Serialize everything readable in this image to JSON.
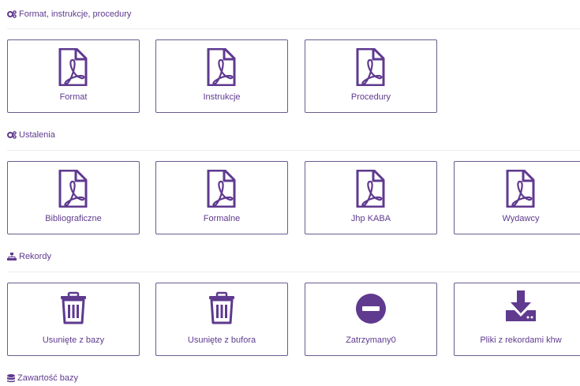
{
  "sections": [
    {
      "title": "Format, instrukcje, procedury",
      "icon": "cogs-icon",
      "tiles": [
        {
          "label": "Format",
          "icon": "pdf-file-icon"
        },
        {
          "label": "Instrukcje",
          "icon": "pdf-file-icon"
        },
        {
          "label": "Procedury",
          "icon": "pdf-file-icon"
        }
      ]
    },
    {
      "title": "Ustalenia",
      "icon": "cogs-icon",
      "tiles": [
        {
          "label": "Bibliograficzne",
          "icon": "pdf-file-icon"
        },
        {
          "label": "Formalne",
          "icon": "pdf-file-icon"
        },
        {
          "label": "Jhp KABA",
          "icon": "pdf-file-icon"
        },
        {
          "label": "Wydawcy",
          "icon": "pdf-file-icon"
        }
      ]
    },
    {
      "title": "Rekordy",
      "icon": "sitemap-icon",
      "tiles": [
        {
          "label": "Usunięte z bazy",
          "icon": "trash-icon"
        },
        {
          "label": "Usunięte z bufora",
          "icon": "trash-icon"
        },
        {
          "label": "Zatrzymany0",
          "icon": "minus-circle-icon"
        },
        {
          "label": "Pliki z rekordami khw",
          "icon": "download-icon"
        }
      ]
    },
    {
      "title": "Zawartość bazy",
      "icon": "database-icon",
      "tiles": []
    }
  ],
  "colors": {
    "accent": "#5f3a8f",
    "border": "#6b5b8f",
    "rule": "#ececf1"
  }
}
